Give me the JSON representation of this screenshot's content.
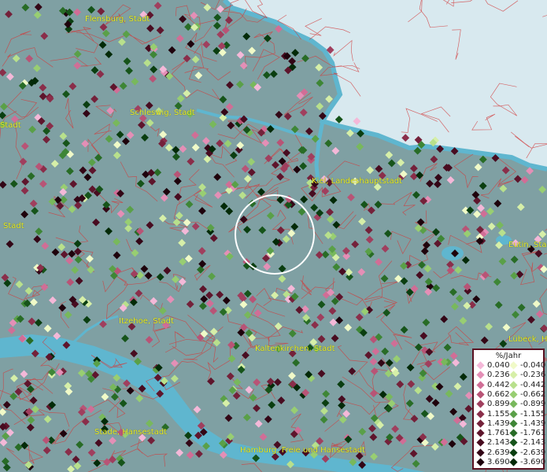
{
  "map": {
    "cities": [
      {
        "name": "Flensburg, Stadt"
      },
      {
        "name": "Schleswig, Stadt"
      },
      {
        "name": "Kiel, Landeshauptstadt"
      },
      {
        "name": "Stadt"
      },
      {
        "name": "Stadt"
      },
      {
        "name": "Eutin, Stadt"
      },
      {
        "name": "Itzehoe, Stadt"
      },
      {
        "name": "Kaltenkirchen, Stadt"
      },
      {
        "name": "Lübeck, H"
      },
      {
        "name": "Stade, Hansestadt"
      },
      {
        "name": "Hamburg, Freie und Hansestadt"
      }
    ]
  },
  "legend": {
    "title": "%/Jahr",
    "positive": [
      {
        "label": "0.040",
        "color": "#f4b8d8"
      },
      {
        "label": "0.236",
        "color": "#e48fb6"
      },
      {
        "label": "0.442",
        "color": "#d06e96"
      },
      {
        "label": "0.662",
        "color": "#b85476"
      },
      {
        "label": "0.899",
        "color": "#a03f5e"
      },
      {
        "label": "1.155",
        "color": "#8a2e4a"
      },
      {
        "label": "1.439",
        "color": "#74213a"
      },
      {
        "label": "1.761",
        "color": "#5e152c"
      },
      {
        "label": "2.143",
        "color": "#480c20"
      },
      {
        "label": "2.639",
        "color": "#330616"
      },
      {
        "label": "3.690",
        "color": "#1e020c"
      }
    ],
    "negative": [
      {
        "label": "-0.040",
        "color": "#f0fac8"
      },
      {
        "label": "-0.236",
        "color": "#d6efa8"
      },
      {
        "label": "-0.442",
        "color": "#b8e08c"
      },
      {
        "label": "-0.662",
        "color": "#98ce72"
      },
      {
        "label": "-0.899",
        "color": "#78b85c"
      },
      {
        "label": "-1.155",
        "color": "#5aa048"
      },
      {
        "label": "-1.439",
        "color": "#3e8636"
      },
      {
        "label": "-1.761",
        "color": "#286c26"
      },
      {
        "label": "-2.143",
        "color": "#16541a"
      },
      {
        "label": "-2.639",
        "color": "#0a3e10"
      },
      {
        "label": "-3.690",
        "color": "#032a08"
      }
    ]
  },
  "colors": {
    "land": "#7fa0a3",
    "water": "#5fb6cf",
    "sea_light": "#d8e9ef",
    "boundary": "#d23a3a",
    "label": "#ecec2a",
    "highlight_ring": "#ffffff"
  }
}
